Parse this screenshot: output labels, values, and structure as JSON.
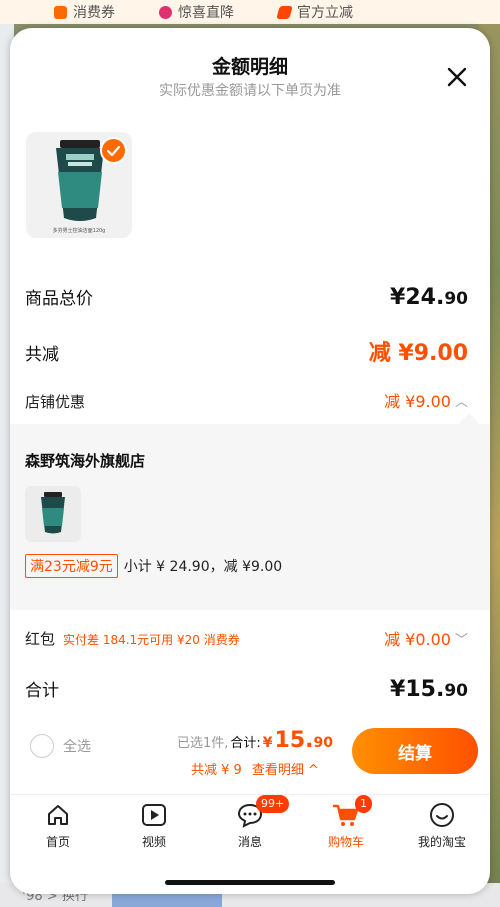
{
  "background": {
    "top_strip": [
      {
        "icon": "coupon-icon",
        "label": "消费券",
        "color": "#ff6a00"
      },
      {
        "icon": "drop-icon",
        "label": "惊喜直降",
        "color": "#e0306f"
      },
      {
        "icon": "bolt-icon",
        "label": "官方立减",
        "color": "#ff4500"
      }
    ],
    "bottom_peek_text": "ʻ98ʻ> 换行"
  },
  "header": {
    "title": "金额明细",
    "subtitle": "实际优惠金额请以下单页为准"
  },
  "product": {
    "caption": "多芬男士控油洁面120g",
    "selected": true
  },
  "summary": {
    "total_label": "商品总价",
    "total_value": "¥24.",
    "total_decimal": "90",
    "discount_label": "共减",
    "discount_value": "减 ¥9.00",
    "shop_discount_label": "店铺优惠",
    "shop_discount_value": "减 ¥9.00"
  },
  "shop": {
    "name": "森野筑海外旗舰店",
    "promo_tag": "满23元减9元",
    "promo_detail": "小计 ¥ 24.90，减 ¥9.00"
  },
  "red_packet": {
    "label": "红包",
    "note": "实付差 184.1元可用 ¥20 消费券",
    "value": "减 ¥0.00"
  },
  "grand_total": {
    "label": "合计",
    "value": "¥15.",
    "decimal": "90"
  },
  "checkout": {
    "select_all": "全选",
    "selected_count": "已选1件,",
    "heji": "合计:",
    "yen": "¥",
    "amount": "15.",
    "amount_decimal": "90",
    "total_discount": "共减 ¥ 9",
    "view_detail": "查看明细 ^",
    "pay_button": "结算"
  },
  "tabbar": [
    {
      "icon": "home-icon",
      "label": "首页"
    },
    {
      "icon": "video-icon",
      "label": "视频"
    },
    {
      "icon": "message-icon",
      "label": "消息",
      "badge": "99+"
    },
    {
      "icon": "cart-icon",
      "label": "购物车",
      "badge": "1",
      "active": true
    },
    {
      "icon": "profile-icon",
      "label": "我的淘宝"
    }
  ],
  "colors": {
    "accent": "#ff5000",
    "accent_light": "#ff9000",
    "text": "#111111",
    "muted": "#999999"
  }
}
